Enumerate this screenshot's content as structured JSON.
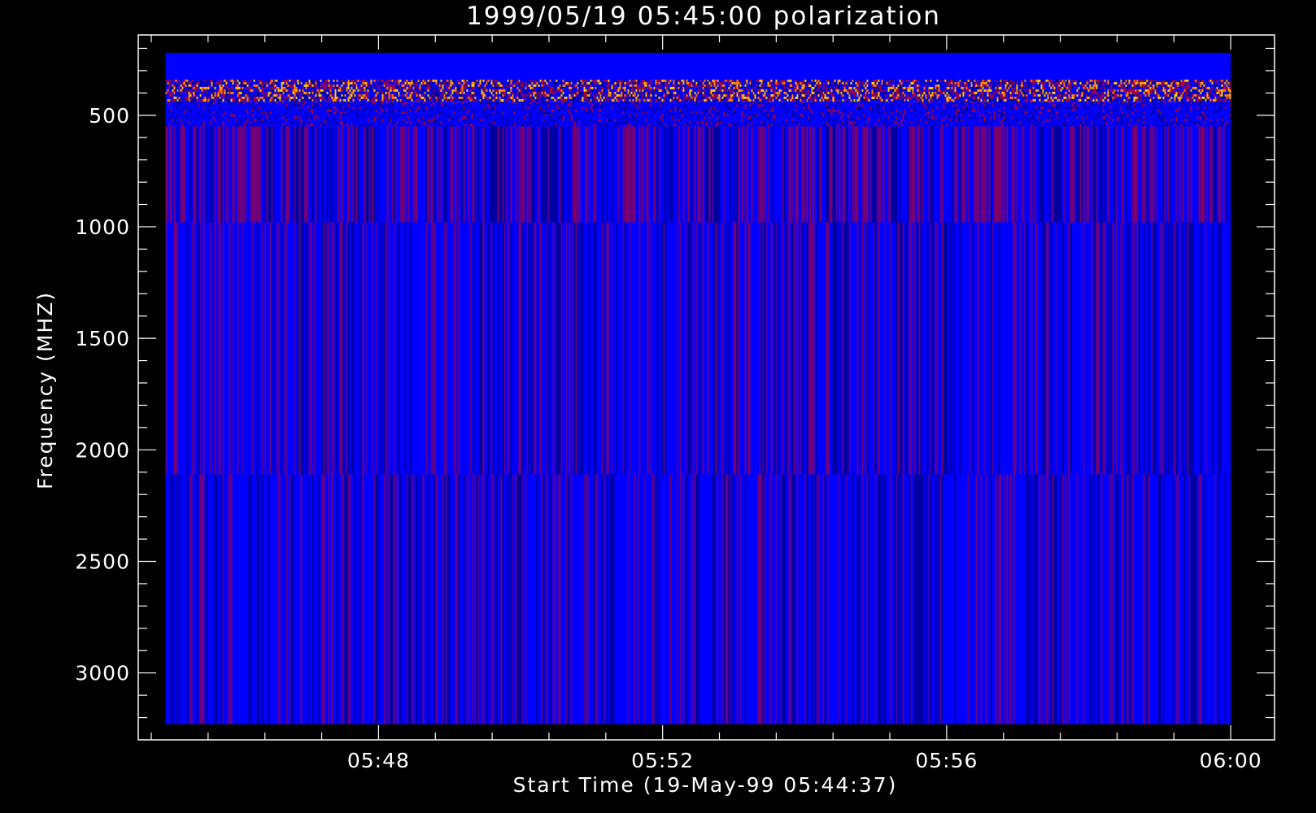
{
  "chart_data": {
    "type": "heatmap",
    "title": "1999/05/19 05:45:00 polarization",
    "xlabel": "Start Time (19-May-99 05:44:37)",
    "ylabel": "Frequency (MHZ)",
    "x_ticks": [
      "05:48",
      "05:52",
      "05:56",
      "06:00"
    ],
    "y_ticks": [
      500,
      1000,
      1500,
      2000,
      2500,
      3000
    ],
    "x_range": [
      "05:44:37",
      "06:00:37"
    ],
    "y_range": [
      3300,
      140
    ],
    "image_x_range": [
      "05:45:00",
      "06:00:00"
    ],
    "image_y_range": [
      3230,
      220
    ],
    "bands": [
      {
        "freq": [
          220,
          340
        ],
        "colormap": "uniform-blue"
      },
      {
        "freq": [
          340,
          440
        ],
        "colormap": "speckled-burst"
      },
      {
        "freq": [
          440,
          550
        ],
        "colormap": "blue-noise"
      },
      {
        "freq": [
          550,
          980
        ],
        "colormap": "blue-red-striped"
      },
      {
        "freq": [
          980,
          2110
        ],
        "colormap": "blue-striped"
      },
      {
        "freq": [
          2110,
          3230
        ],
        "colormap": "blue-striped"
      }
    ],
    "colors": {
      "background": "#000000",
      "base": "#0000ff",
      "dark": "#0000a0",
      "red": "#a00040",
      "orange": "#ff8000",
      "yellow": "#ffd000",
      "axes": "#ffffff"
    },
    "grid": false
  }
}
